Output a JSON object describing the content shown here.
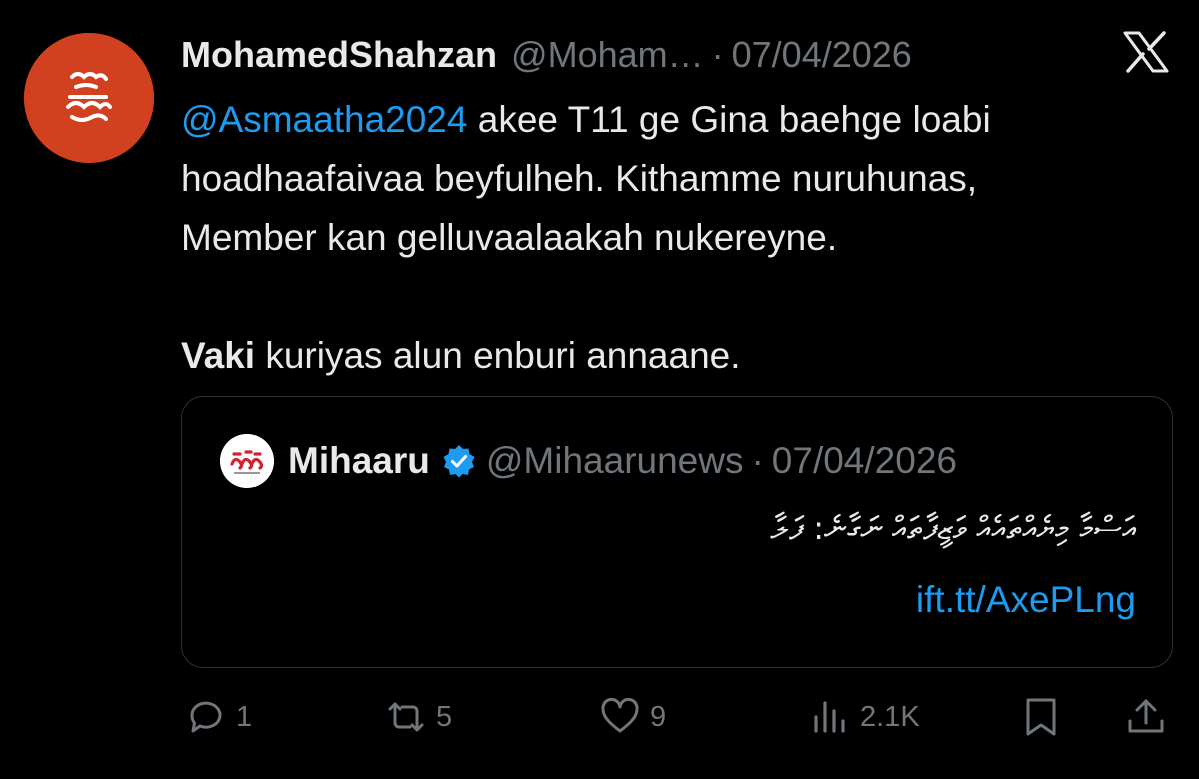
{
  "tweet": {
    "author": {
      "display_name": "MohamedShahzan",
      "handle": "@Moham…",
      "avatar_color": "#d1401f"
    },
    "separator": "·",
    "date": "07/04/2026",
    "platform_icon": "x-logo-icon",
    "text": {
      "line1_mention": "@Asmaatha2024",
      "line1_rest": " akee T11 ge Gina baehge loabi",
      "line2": "hoadhaafaivaa beyfulheh. Kithamme nuruhunas,",
      "line3": "Member kan gelluvaalaakah nukereyne.",
      "line5_bold": "Vaki",
      "line5_rest": " kuriyas alun enburi annaane."
    }
  },
  "quoted_tweet": {
    "display_name": "Mihaaru",
    "verified_icon": "verified-badge-icon",
    "verified_color": "#1d9bf0",
    "handle": "@Mihaarunews",
    "separator": "·",
    "date": "07/04/2026",
    "text": "އަސްމާ މިޔެއްތައެއް ވަޒީފާތައް ނަގާނެ: ފަލާ",
    "link": "ift.tt/AxePLng"
  },
  "actions": {
    "reply": {
      "icon": "reply-icon",
      "count": "1"
    },
    "retweet": {
      "icon": "retweet-icon",
      "count": "5"
    },
    "like": {
      "icon": "heart-icon",
      "count": "9"
    },
    "views": {
      "icon": "views-icon",
      "count": "2.1K"
    },
    "bookmark": {
      "icon": "bookmark-icon"
    },
    "share": {
      "icon": "share-icon"
    }
  },
  "colors": {
    "background": "#000000",
    "text_primary": "#e7e9ea",
    "text_secondary": "#71767b",
    "accent": "#1d9bf0",
    "border": "#2f3336"
  }
}
